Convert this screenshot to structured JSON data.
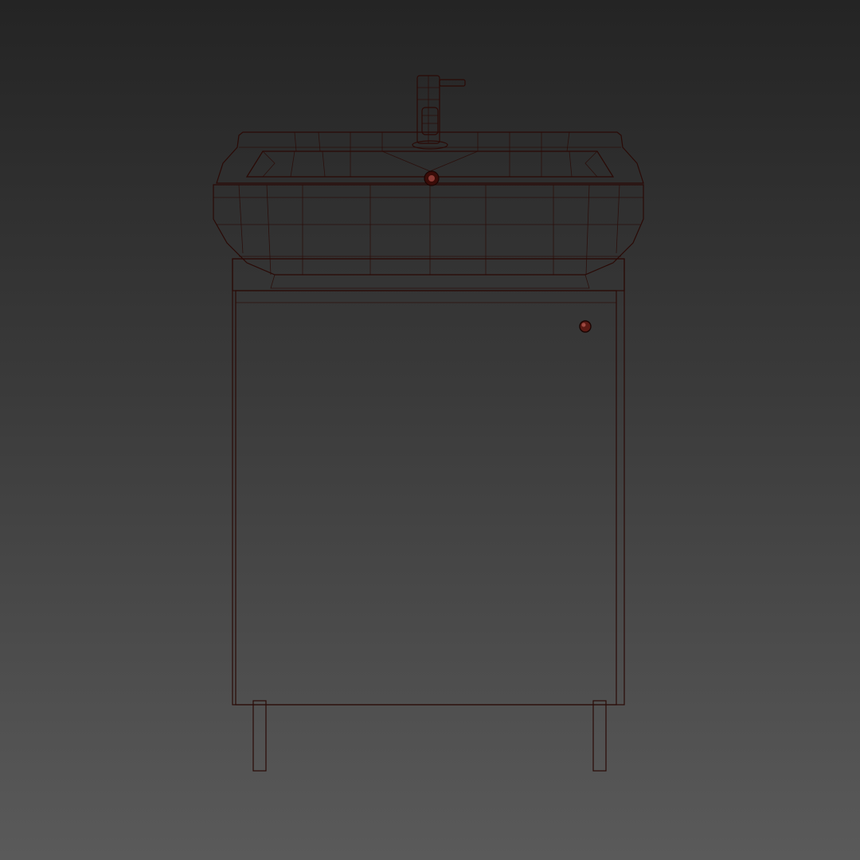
{
  "scene": {
    "background_top": "#242424",
    "background_bottom": "#5a5a5a",
    "model": {
      "object": "bathroom-vanity-with-sink",
      "display_mode": "shaded-with-wireframe",
      "colors": {
        "cabinet": "#9e413c",
        "cabinet_shadow": "#8a3430",
        "basin_outer_light": "#c4463c",
        "basin_outer_mid": "#a5342c",
        "basin_outer_dark": "#7a1812",
        "basin_inner": "#b45a55",
        "wire": "#2a0a06"
      }
    }
  }
}
